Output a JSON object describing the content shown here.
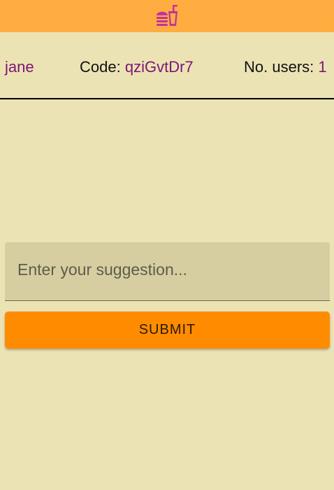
{
  "header": {
    "logo_icon": "fast-food-icon",
    "logo_color": "#c2329c",
    "background": "#ffac41"
  },
  "info": {
    "username": "jane",
    "code_label": "Code:",
    "code_value": "qziGvtDr7",
    "users_label": "No. users:",
    "users_count": "1",
    "accent_color": "#7c1674"
  },
  "form": {
    "suggestion_placeholder": "Enter your suggestion...",
    "suggestion_value": "",
    "submit_label": "SUBMIT",
    "submit_color": "#ff8c00"
  },
  "page": {
    "background": "#ece3b5"
  }
}
